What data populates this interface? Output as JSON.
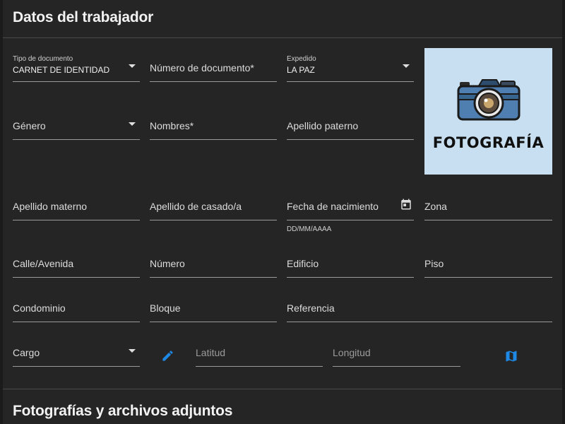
{
  "section_title": "Datos del trabajador",
  "section2_title": "Fotografías y archivos adjuntos",
  "fields": {
    "tipo_documento": {
      "label": "Tipo de documento",
      "value": "CARNET DE IDENTIDAD"
    },
    "numero_documento": {
      "label": "Número de documento*"
    },
    "expedido": {
      "label": "Expedido",
      "value": "LA PAZ"
    },
    "genero": {
      "label": "Género"
    },
    "nombres": {
      "label": "Nombres*"
    },
    "apellido_paterno": {
      "label": "Apellido paterno"
    },
    "apellido_materno": {
      "label": "Apellido materno"
    },
    "apellido_casado": {
      "label": "Apellido de casado/a"
    },
    "fecha_nacimiento": {
      "label": "Fecha de nacimiento",
      "hint": "DD/MM/AAAA"
    },
    "zona": {
      "label": "Zona"
    },
    "calle": {
      "label": "Calle/Avenida"
    },
    "numero": {
      "label": "Número"
    },
    "edificio": {
      "label": "Edificio"
    },
    "piso": {
      "label": "Piso"
    },
    "condominio": {
      "label": "Condominio"
    },
    "bloque": {
      "label": "Bloque"
    },
    "referencia": {
      "label": "Referencia"
    },
    "cargo": {
      "label": "Cargo"
    },
    "latitud": {
      "label": "Latitud"
    },
    "longitud": {
      "label": "Longitud"
    }
  },
  "photo": {
    "text": "FOTOGRAFÍA",
    "icon": "camera-icon"
  },
  "icons": {
    "edit": "pencil-icon",
    "map": "map-icon",
    "calendar": "calendar-icon"
  },
  "colors": {
    "accent": "#1e88e5",
    "background": "#252525",
    "photo_bg": "#c7dff0"
  }
}
